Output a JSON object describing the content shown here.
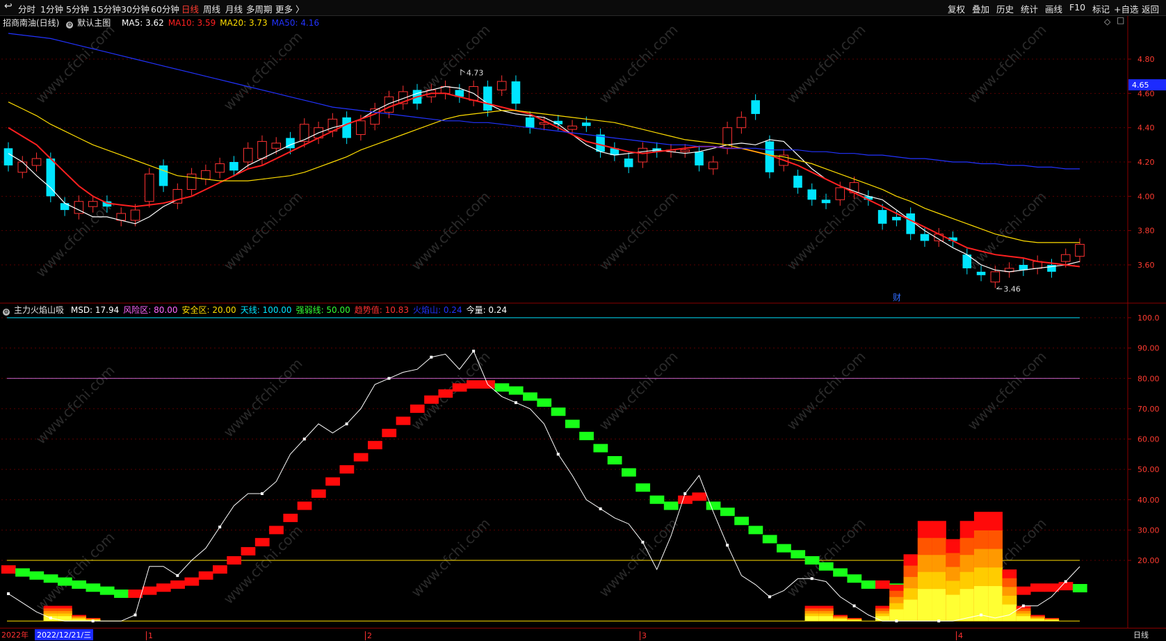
{
  "toolbar": {
    "back_icon": "back-arrow-icon",
    "periods": [
      "分时",
      "1分钟",
      "5分钟",
      "15分钟",
      "30分钟",
      "60分钟",
      "日线",
      "周线",
      "月线",
      "多周期",
      "更多 〉"
    ],
    "active_period": "日线",
    "right_items": [
      "复权",
      "叠加",
      "历史",
      "统计",
      "画线",
      "F10",
      "标记",
      "+自选",
      "返回"
    ]
  },
  "main_legend": {
    "stock": "招商南油(日线)",
    "template": "默认主图",
    "ma": [
      {
        "label": "MA5: 3.62",
        "color": "#ffffff"
      },
      {
        "label": "MA10: 3.59",
        "color": "#ff2020"
      },
      {
        "label": "MA20: 3.73",
        "color": "#ffdd00"
      },
      {
        "label": "MA50: 4.16",
        "color": "#2233ff"
      }
    ]
  },
  "price_axis": {
    "ticks": [
      "4.80",
      "4.60",
      "4.40",
      "4.20",
      "4.00",
      "3.80",
      "3.60"
    ],
    "current_price": "4.65",
    "high_label": "4.73",
    "low_label": "3.46",
    "event_marker": "财"
  },
  "indicator_legend": {
    "name": "主力火焰山吸",
    "items": [
      {
        "label": "MSD: 17.94",
        "color": "#ffffff"
      },
      {
        "label": "风险区: 80.00",
        "color": "#ff66ff"
      },
      {
        "label": "安全区: 20.00",
        "color": "#ffdd00"
      },
      {
        "label": "天线: 100.00",
        "color": "#00e5ff"
      },
      {
        "label": "强弱线: 50.00",
        "color": "#33ff33"
      },
      {
        "label": "趋势值: 10.83",
        "color": "#ff3030"
      },
      {
        "label": "火焰山: 0.24",
        "color": "#2233ff"
      },
      {
        "label": "今量: 0.24",
        "color": "#ffffff"
      }
    ]
  },
  "indicator_axis": {
    "ticks": [
      "100.0",
      "90.00",
      "80.00",
      "70.00",
      "60.00",
      "50.00",
      "40.00",
      "30.00",
      "20.00"
    ]
  },
  "date_axis": {
    "year_label": "2022年",
    "cursor_date": "2022/12/21/三",
    "months": [
      "1",
      "2",
      "3",
      "4"
    ],
    "period_label": "日线"
  },
  "watermark": "www.cfchi.com",
  "colors": {
    "up": "#ff3232",
    "down": "#00e5ff",
    "grid": "#5a0000",
    "axis": "#8a0000"
  },
  "chart_data": [
    {
      "type": "line",
      "title": "招商南油(日线)",
      "series": [
        {
          "name": "MA5",
          "values": [
            4.25,
            4.2,
            4.12,
            4.05,
            3.96,
            3.92,
            3.88,
            3.88,
            3.86,
            3.84,
            3.88,
            3.94,
            3.98,
            4.0,
            4.04,
            4.08,
            4.12,
            4.18,
            4.22,
            4.26,
            4.3,
            4.33,
            4.37,
            4.4,
            4.42,
            4.45,
            4.5,
            4.54,
            4.57,
            4.6,
            4.62,
            4.64,
            4.63,
            4.6,
            4.54,
            4.5,
            4.48,
            4.47,
            4.46,
            4.42,
            4.36,
            4.3,
            4.26,
            4.24,
            4.25,
            4.26,
            4.27,
            4.26,
            4.25,
            4.26,
            4.28,
            4.3,
            4.31,
            4.3,
            4.33,
            4.32,
            4.24,
            4.16,
            4.1,
            4.06,
            4.03,
            4.0,
            3.98,
            3.92,
            3.86,
            3.8,
            3.75,
            3.7,
            3.66,
            3.6,
            3.57,
            3.56,
            3.57,
            3.58,
            3.59,
            3.6,
            3.62
          ]
        },
        {
          "name": "MA10",
          "values": [
            4.4,
            4.35,
            4.3,
            4.22,
            4.14,
            4.06,
            4.0,
            3.96,
            3.95,
            3.94,
            3.95,
            3.96,
            3.98,
            4.0,
            4.04,
            4.08,
            4.12,
            4.16,
            4.18,
            4.22,
            4.26,
            4.3,
            4.34,
            4.38,
            4.42,
            4.45,
            4.48,
            4.52,
            4.55,
            4.58,
            4.6,
            4.6,
            4.58,
            4.56,
            4.54,
            4.52,
            4.5,
            4.48,
            4.44,
            4.4,
            4.36,
            4.32,
            4.3,
            4.28,
            4.26,
            4.25,
            4.26,
            4.27,
            4.28,
            4.29,
            4.29,
            4.28,
            4.28,
            4.26,
            4.24,
            4.21,
            4.18,
            4.14,
            4.1,
            4.06,
            4.02,
            3.98,
            3.94,
            3.9,
            3.86,
            3.82,
            3.78,
            3.74,
            3.7,
            3.68,
            3.66,
            3.65,
            3.64,
            3.62,
            3.61,
            3.6,
            3.59
          ]
        },
        {
          "name": "MA20",
          "values": [
            4.55,
            4.51,
            4.47,
            4.42,
            4.38,
            4.34,
            4.3,
            4.27,
            4.24,
            4.21,
            4.18,
            4.15,
            4.12,
            4.11,
            4.1,
            4.09,
            4.09,
            4.09,
            4.1,
            4.11,
            4.12,
            4.14,
            4.17,
            4.2,
            4.23,
            4.27,
            4.3,
            4.33,
            4.36,
            4.39,
            4.42,
            4.45,
            4.47,
            4.48,
            4.49,
            4.5,
            4.5,
            4.49,
            4.48,
            4.47,
            4.46,
            4.45,
            4.44,
            4.43,
            4.41,
            4.39,
            4.37,
            4.35,
            4.33,
            4.32,
            4.31,
            4.3,
            4.28,
            4.26,
            4.24,
            4.23,
            4.21,
            4.19,
            4.16,
            4.13,
            4.1,
            4.07,
            4.04,
            4.0,
            3.97,
            3.93,
            3.9,
            3.87,
            3.84,
            3.81,
            3.78,
            3.76,
            3.74,
            3.73,
            3.73,
            3.73,
            3.73
          ]
        },
        {
          "name": "MA50",
          "values": [
            4.95,
            4.94,
            4.93,
            4.92,
            4.9,
            4.88,
            4.86,
            4.84,
            4.82,
            4.8,
            4.78,
            4.76,
            4.74,
            4.72,
            4.7,
            4.68,
            4.66,
            4.64,
            4.62,
            4.6,
            4.58,
            4.56,
            4.54,
            4.52,
            4.51,
            4.5,
            4.49,
            4.48,
            4.47,
            4.46,
            4.45,
            4.44,
            4.44,
            4.43,
            4.43,
            4.42,
            4.41,
            4.4,
            4.39,
            4.38,
            4.37,
            4.36,
            4.35,
            4.34,
            4.33,
            4.32,
            4.31,
            4.3,
            4.3,
            4.29,
            4.29,
            4.28,
            4.28,
            4.28,
            4.27,
            4.27,
            4.27,
            4.26,
            4.26,
            4.25,
            4.25,
            4.24,
            4.24,
            4.23,
            4.22,
            4.22,
            4.21,
            4.2,
            4.2,
            4.19,
            4.19,
            4.18,
            4.18,
            4.17,
            4.17,
            4.16,
            4.16
          ]
        }
      ],
      "candles": [
        [
          4.28,
          4.18
        ],
        [
          4.14,
          4.2
        ],
        [
          4.18,
          4.22
        ],
        [
          4.22,
          4.0
        ],
        [
          3.96,
          3.92
        ],
        [
          3.9,
          3.97
        ],
        [
          3.94,
          3.97
        ],
        [
          3.97,
          3.94
        ],
        [
          3.86,
          3.9
        ],
        [
          3.86,
          3.92
        ],
        [
          3.97,
          4.13
        ],
        [
          4.18,
          4.06
        ],
        [
          3.96,
          4.04
        ],
        [
          4.04,
          4.13
        ],
        [
          4.1,
          4.15
        ],
        [
          4.14,
          4.19
        ],
        [
          4.2,
          4.15
        ],
        [
          4.2,
          4.28
        ],
        [
          4.22,
          4.32
        ],
        [
          4.28,
          4.31
        ],
        [
          4.34,
          4.28
        ],
        [
          4.32,
          4.42
        ],
        [
          4.34,
          4.4
        ],
        [
          4.38,
          4.45
        ],
        [
          4.46,
          4.34
        ],
        [
          4.36,
          4.44
        ],
        [
          4.42,
          4.51
        ],
        [
          4.49,
          4.58
        ],
        [
          4.54,
          4.61
        ],
        [
          4.62,
          4.54
        ],
        [
          4.58,
          4.62
        ],
        [
          4.6,
          4.64
        ],
        [
          4.62,
          4.58
        ],
        [
          4.56,
          4.64
        ],
        [
          4.64,
          4.5
        ],
        [
          4.62,
          4.67
        ],
        [
          4.67,
          4.54
        ],
        [
          4.46,
          4.4
        ],
        [
          4.42,
          4.43
        ],
        [
          4.44,
          4.42
        ],
        [
          4.39,
          4.41
        ],
        [
          4.43,
          4.41
        ],
        [
          4.36,
          4.26
        ],
        [
          4.28,
          4.24
        ],
        [
          4.22,
          4.17
        ],
        [
          4.2,
          4.28
        ],
        [
          4.28,
          4.26
        ],
        [
          4.26,
          4.27
        ],
        [
          4.26,
          4.27
        ],
        [
          4.26,
          4.18
        ],
        [
          4.16,
          4.2
        ],
        [
          4.28,
          4.4
        ],
        [
          4.4,
          4.46
        ],
        [
          4.56,
          4.48
        ],
        [
          4.32,
          4.14
        ],
        [
          4.18,
          4.24
        ],
        [
          4.12,
          4.05
        ],
        [
          4.04,
          3.98
        ],
        [
          3.98,
          3.96
        ],
        [
          3.98,
          4.05
        ],
        [
          4.02,
          4.08
        ],
        [
          4.0,
          3.98
        ],
        [
          3.92,
          3.84
        ],
        [
          3.88,
          3.86
        ],
        [
          3.9,
          3.78
        ],
        [
          3.78,
          3.74
        ],
        [
          3.74,
          3.78
        ],
        [
          3.76,
          3.74
        ],
        [
          3.66,
          3.58
        ],
        [
          3.56,
          3.54
        ],
        [
          3.5,
          3.56
        ],
        [
          3.56,
          3.58
        ],
        [
          3.6,
          3.57
        ],
        [
          3.58,
          3.62
        ],
        [
          3.6,
          3.56
        ],
        [
          3.62,
          3.66
        ],
        [
          3.65,
          3.72
        ]
      ]
    },
    {
      "type": "line",
      "title": "主力火焰山吸",
      "series": [
        {
          "name": "MSD",
          "values": [
            9,
            6,
            3,
            1,
            0,
            0,
            0,
            0,
            0,
            2,
            18,
            18,
            15,
            20,
            24,
            31,
            38,
            42,
            42,
            46,
            55,
            60,
            65,
            62,
            65,
            70,
            78,
            80,
            82,
            83,
            87,
            88,
            83,
            89,
            78,
            74,
            72,
            70,
            65,
            55,
            48,
            40,
            37,
            34,
            32,
            26,
            17,
            28,
            42,
            48,
            36,
            25,
            15,
            12,
            8,
            10,
            14,
            14,
            13,
            8,
            5,
            2,
            0,
            0,
            0,
            0,
            0,
            0,
            1,
            2,
            1,
            2,
            5,
            5,
            8,
            13,
            17.94
          ]
        },
        {
          "name": "趋势值",
          "values": [
            17,
            16,
            15,
            14,
            13,
            12,
            11,
            10,
            9,
            9,
            10,
            11,
            12,
            13,
            15,
            17,
            20,
            23,
            26,
            30,
            34,
            38,
            42,
            46,
            50,
            54,
            58,
            62,
            66,
            70,
            73,
            75,
            77,
            78,
            78,
            77,
            76,
            74,
            72,
            69,
            65,
            61,
            57,
            53,
            49,
            44,
            40,
            38,
            40,
            41,
            38,
            36,
            33,
            30,
            27,
            24,
            22,
            20,
            18,
            16,
            14,
            12,
            12,
            11,
            11,
            11,
            11,
            11,
            11,
            10,
            10,
            10,
            10,
            11,
            11,
            11.5,
            10.83
          ]
        },
        {
          "name": "火焰山",
          "values": [
            0,
            0,
            0,
            5,
            5,
            2,
            1,
            0,
            0,
            0,
            0,
            0,
            0,
            0,
            0,
            0,
            0,
            0,
            0,
            0,
            0,
            0,
            0,
            0,
            0,
            0,
            0,
            0,
            0,
            0,
            0,
            0,
            0,
            0,
            0,
            0,
            0,
            0,
            0,
            0,
            0,
            0,
            0,
            0,
            0,
            0,
            0,
            0,
            0,
            0,
            0,
            0,
            0,
            0,
            0,
            0,
            0,
            5,
            5,
            2,
            1,
            0,
            5,
            12,
            22,
            33,
            33,
            27,
            33,
            36,
            36,
            17,
            5,
            2,
            1,
            0,
            0
          ]
        }
      ],
      "ylim": [
        0,
        100
      ]
    }
  ]
}
